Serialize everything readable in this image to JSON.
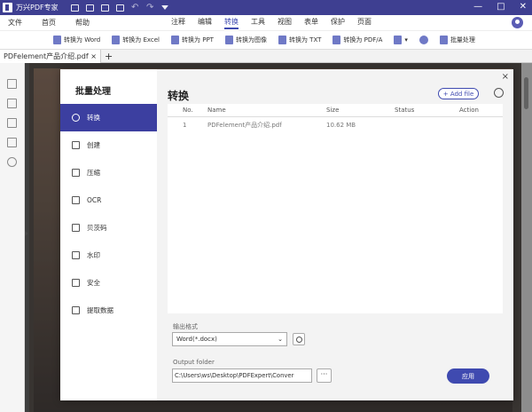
{
  "app": {
    "title": "万兴PDF专家"
  },
  "window_controls": {
    "minimize": "—",
    "maximize": "□",
    "close": "✕"
  },
  "menu": {
    "left": [
      "文件",
      "首页",
      "帮助"
    ],
    "center": [
      "注释",
      "编辑",
      "转换",
      "工具",
      "视图",
      "表单",
      "保护",
      "页面"
    ],
    "active": "转换"
  },
  "toolbar": {
    "items": [
      "转换为 Word",
      "转换为 Excel",
      "转换为 PPT",
      "转换为图像",
      "转换为 TXT",
      "转换为 PDF/A",
      "",
      "批量处理"
    ]
  },
  "tabs": {
    "doc_tab": "PDFelement产品介绍.pdf",
    "close": "×",
    "add": "+"
  },
  "dialog": {
    "sidebar_title": "批量处理",
    "sidebar_items": [
      {
        "label": "转换",
        "icon": "refresh-icon"
      },
      {
        "label": "创建",
        "icon": "create-icon"
      },
      {
        "label": "压缩",
        "icon": "compress-icon"
      },
      {
        "label": "OCR",
        "icon": "ocr-icon"
      },
      {
        "label": "贝茨码",
        "icon": "bates-icon"
      },
      {
        "label": "水印",
        "icon": "watermark-icon"
      },
      {
        "label": "安全",
        "icon": "lock-icon"
      },
      {
        "label": "提取数据",
        "icon": "chart-icon"
      }
    ],
    "active_item": "转换",
    "main_title": "转换",
    "add_file": "+ Add file",
    "close": "×",
    "table": {
      "headers": [
        "No.",
        "Name",
        "Size",
        "Status",
        "Action"
      ],
      "rows": [
        {
          "no": "1",
          "name": "PDFelement产品介绍.pdf",
          "size": "10.62 MB",
          "status": "",
          "action": ""
        }
      ]
    },
    "output_format_label": "输出格式",
    "output_format_value": "Word(*.docx)",
    "output_folder_label": "Output folder",
    "output_folder_value": "C:\\Users\\ws\\Desktop\\PDFExpert\\Conver",
    "browse": "···",
    "apply": "应用"
  }
}
